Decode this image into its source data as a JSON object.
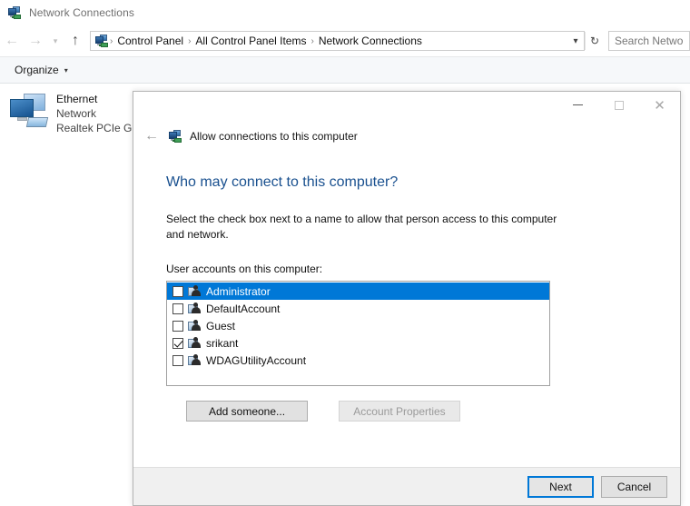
{
  "window": {
    "title": "Network Connections",
    "icon": "network-connections-icon"
  },
  "addressbar": {
    "back_icon": "back-arrow-icon",
    "forward_icon": "forward-arrow-icon",
    "history_icon": "chevron-down-icon",
    "up_icon": "up-arrow-icon",
    "path_icon": "network-connections-icon",
    "crumbs": [
      "Control Panel",
      "All Control Panel Items",
      "Network Connections"
    ],
    "separator": "›",
    "dropdown_icon": "chevron-down-icon",
    "refresh_icon": "refresh-icon",
    "search_placeholder": "Search Netwo"
  },
  "commandbar": {
    "organize_label": "Organize",
    "organize_caret": "▾"
  },
  "content": {
    "adapter": {
      "name": "Ethernet",
      "status": "Network",
      "device": "Realtek PCIe G",
      "icon": "network-adapter-icon"
    }
  },
  "dialog": {
    "caption": {
      "minimize_icon": "minimize-icon",
      "maximize_icon": "maximize-icon",
      "close_icon": "close-icon"
    },
    "back_icon": "back-arrow-icon",
    "title_icon": "network-connections-icon",
    "title": "Allow connections to this computer",
    "heading": "Who may connect to this computer?",
    "instruction": "Select the check box next to a name to allow that person access to this computer and network.",
    "list_label": "User accounts on this computer:",
    "accounts": [
      {
        "name": "Administrator",
        "checked": false,
        "selected": true
      },
      {
        "name": "DefaultAccount",
        "checked": false,
        "selected": false
      },
      {
        "name": "Guest",
        "checked": false,
        "selected": false
      },
      {
        "name": "srikant",
        "checked": true,
        "selected": false
      },
      {
        "name": "WDAGUtilityAccount",
        "checked": false,
        "selected": false
      }
    ],
    "add_someone_label": "Add someone...",
    "account_properties_label": "Account Properties",
    "account_properties_enabled": false,
    "next_label": "Next",
    "cancel_label": "Cancel",
    "accent_color": "#0078d7",
    "heading_color": "#19508f"
  }
}
